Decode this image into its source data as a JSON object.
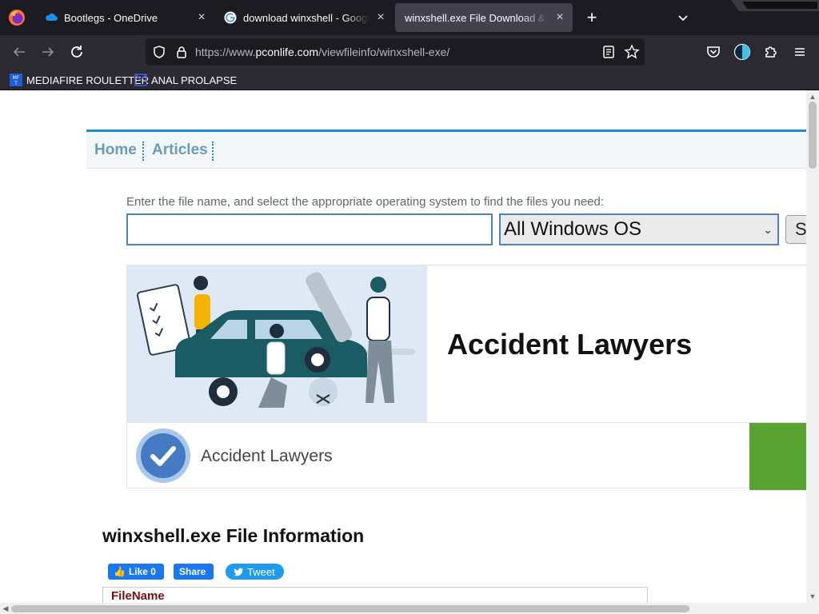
{
  "browser": {
    "tabs": [
      {
        "title": "Bootlegs - OneDrive",
        "favicon": "onedrive-cloud-icon",
        "active": false
      },
      {
        "title": "download winxshell - Google S",
        "favicon": "google-g-icon",
        "active": false
      },
      {
        "title": "winxshell.exe File Download & Fix F",
        "favicon": "none",
        "active": true
      }
    ],
    "url": {
      "prefix": "https://www.",
      "host": "pconlife.com",
      "path": "/viewfileinfo/winxshell-exe/"
    },
    "bookmarks": [
      {
        "label": "MEDIAFIRE ROULETTER",
        "icon": "mediafire-roulette-icon"
      },
      {
        "label": "ANAL PROLAPSE",
        "icon": "bookmark-folder-icon"
      }
    ]
  },
  "page": {
    "nav": {
      "home": "Home",
      "articles": "Articles"
    },
    "search": {
      "hint": "Enter the file name, and select the appropriate operating system to find the files you need:",
      "input_value": "",
      "os_selected": "All Windows OS",
      "button_label": "S"
    },
    "ad": {
      "headline": "Accident Lawyers",
      "brand": "Accident Lawyers",
      "cta_color": "#5aa332"
    },
    "section_title": "winxshell.exe File Information",
    "share": {
      "like": "Like 0",
      "share": "Share",
      "tweet": "Tweet"
    },
    "table": {
      "header": "FileName"
    }
  },
  "colors": {
    "accent": "#1a8fc6",
    "nav_link": "#6a9cb8",
    "table_header": "#7a0c1a",
    "facebook": "#1877f2",
    "twitter": "#1d9bf0"
  }
}
